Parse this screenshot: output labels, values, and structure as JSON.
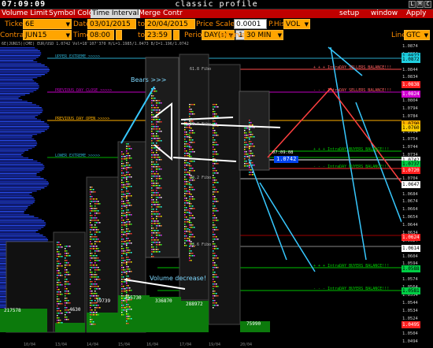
{
  "window": {
    "clock": "07:09:09",
    "title": "classic profile",
    "buttons": [
      "L",
      "M",
      "C"
    ]
  },
  "menu": {
    "left": [
      "Volume Limit",
      "Symbol Color",
      "Time Interval",
      "Merge Contr"
    ],
    "right": [
      "setup",
      "window",
      "Apply"
    ]
  },
  "controls": {
    "ticker_label": "Ticker",
    "ticker": "6E",
    "date_label": "Date",
    "date_from": "03/01/2015",
    "to1": "to",
    "date_to": "20/04/2015",
    "price_scale_label": "Price Scale",
    "price_scale": "0.0001",
    "phist_label": "P.Hist",
    "phist": "VOL",
    "contract_label": "Contract",
    "contract": "JUN15",
    "time_label": "Time",
    "time_from": "08:00",
    "to2": "to",
    "time_to": "23:59",
    "period_label": "Period",
    "period": "DAY(s)",
    "period_count": "1",
    "interval_label": "Interval",
    "interval": "30 MIN",
    "line_label": "Line",
    "line": "GTC"
  },
  "chart": {
    "header": "6E(JUN15)(CME) EUR/USD  1.0742  Vol=18'107'370  H/L=1.1985/1.0473  B/I=1.196/1.0742",
    "annotations": {
      "bears": "Bears >>>",
      "volume": "Volume decrease!"
    },
    "level_labels": [
      "UPPER EXTREME >>>>>",
      "PREVIOUS DAY CLOSE >>>>>",
      "PREVIOUS DAY OPEN >>>>>",
      "LOWER EXTREME >>>>>",
      "61.8 Fibo",
      "50.0 Fibo",
      "38.2 Fibo",
      "23.6 Fibo",
      "+ + + IntraDAY SELLERS BALANCE!!!",
      "- - - IntraDAY SELLERS BALANCE!!!",
      "+ + + IntraDAY BUYERS BALANCE!!!",
      "- - - IntraDAY BUYERS BALANCE!!!",
      "+ + + IntraDAY BUYERS BALANCE!!!",
      "- - - IntraDAY BUYERS BALANCE!!!"
    ],
    "volumes": [
      "217578",
      "4630",
      "39739",
      "355730",
      "336870",
      "288972",
      "75990"
    ],
    "current_time": "07:09:08",
    "current_price": "1.0742",
    "dates": [
      "10/04",
      "13/04",
      "14/04",
      "15/04",
      "16/04",
      "17/04",
      "19/04",
      "20/04"
    ]
  },
  "price_axis": {
    "labels": [
      "1.0874",
      "1.0864",
      "1.0854",
      "1.0844",
      "1.0834",
      "1.0824",
      "1.0814",
      "1.0804",
      "1.0794",
      "1.0784",
      "1.0774",
      "1.0764",
      "1.0754",
      "1.0744",
      "1.0734",
      "1.0724",
      "1.0714",
      "1.0704",
      "1.0694",
      "1.0684",
      "1.0674",
      "1.0664",
      "1.0654",
      "1.0644",
      "1.0634",
      "1.0624",
      "1.0614",
      "1.0604",
      "1.0594",
      "1.0584",
      "1.0574",
      "1.0564",
      "1.0554",
      "1.0544",
      "1.0534",
      "1.0524",
      "1.0514",
      "1.0504",
      "1.0494"
    ],
    "badges": [
      "1.0877",
      "1.0872",
      "1.0838",
      "1.0824",
      "1.0790",
      "1.0760",
      "1.0742",
      "1.0737",
      "1.0720",
      "1.0647",
      "1.0624",
      "1.0614",
      "1.0588",
      "1.0581",
      "1.0495"
    ]
  }
}
